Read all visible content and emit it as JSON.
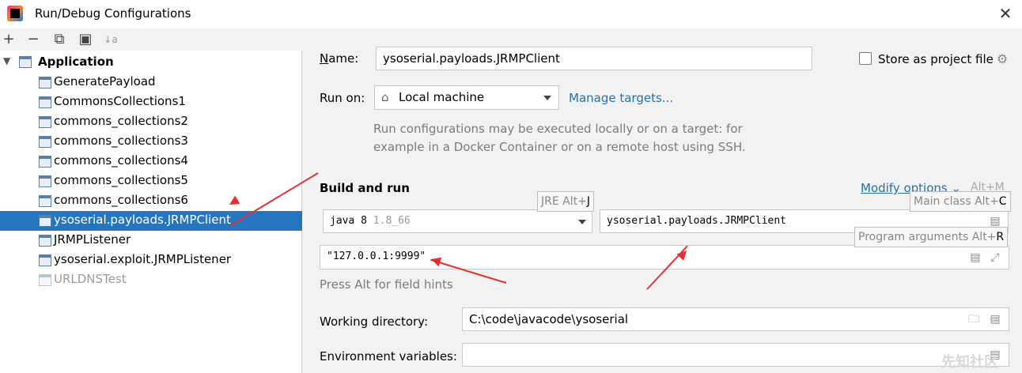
{
  "window": {
    "title": "Run/Debug Configurations",
    "close_glyph": "✕"
  },
  "toolbar": {
    "add_glyph": "+",
    "remove_glyph": "−",
    "copy_glyph": "⧉",
    "folder_glyph": "▣",
    "sort_glyph": "↓a"
  },
  "tree": {
    "root_label": "Application",
    "items": [
      {
        "label": "GeneratePayload",
        "selected": false,
        "disabled": false
      },
      {
        "label": "CommonsCollections1",
        "selected": false,
        "disabled": false
      },
      {
        "label": "commons_collections2",
        "selected": false,
        "disabled": false
      },
      {
        "label": "commons_collections3",
        "selected": false,
        "disabled": false
      },
      {
        "label": "commons_collections4",
        "selected": false,
        "disabled": false
      },
      {
        "label": "commons_collections5",
        "selected": false,
        "disabled": false
      },
      {
        "label": "commons_collections6",
        "selected": false,
        "disabled": false
      },
      {
        "label": "ysoserial.payloads.JRMPClient",
        "selected": true,
        "disabled": false
      },
      {
        "label": "JRMPListener",
        "selected": false,
        "disabled": false
      },
      {
        "label": "ysoserial.exploit.JRMPListener",
        "selected": false,
        "disabled": false
      },
      {
        "label": "URLDNSTest",
        "selected": false,
        "disabled": true
      }
    ]
  },
  "form": {
    "name_label": "Name:",
    "name_value": "ysoserial.payloads.JRMPClient",
    "store_label": "Store as project file",
    "store_checked": false,
    "run_on_label": "Run on:",
    "run_on_value": "Local machine",
    "manage_targets": "Manage targets...",
    "run_on_hint_1": "Run configurations may be executed locally or on a target: for",
    "run_on_hint_2": "example in a Docker Container or on a remote host using SSH.",
    "build_and_run": "Build and run",
    "modify_options": "Modify options",
    "modify_shortcut": "Alt+M",
    "jre_value": "java 8",
    "jre_version": "1.8_66",
    "jre_tooltip_prefix": "JRE Alt+",
    "jre_tooltip_key": "J",
    "main_class_value": "ysoserial.payloads.JRMPClient",
    "main_class_tooltip_prefix": "Main class Alt+",
    "main_class_tooltip_key": "C",
    "program_args_value": "\"127.0.0.1:9999\"",
    "program_args_tooltip_prefix": "Program arguments Alt+",
    "program_args_tooltip_key": "R",
    "field_hints": "Press Alt for field hints",
    "working_dir_label": "Working directory:",
    "working_dir_value": "C:\\code\\javacode\\ysoserial",
    "env_vars_label": "Environment variables:",
    "env_vars_value": ""
  },
  "watermark": "先知社区",
  "colors": {
    "selection": "#2675bf",
    "link": "#2470b3",
    "annotation_arrow": "#e63030"
  }
}
